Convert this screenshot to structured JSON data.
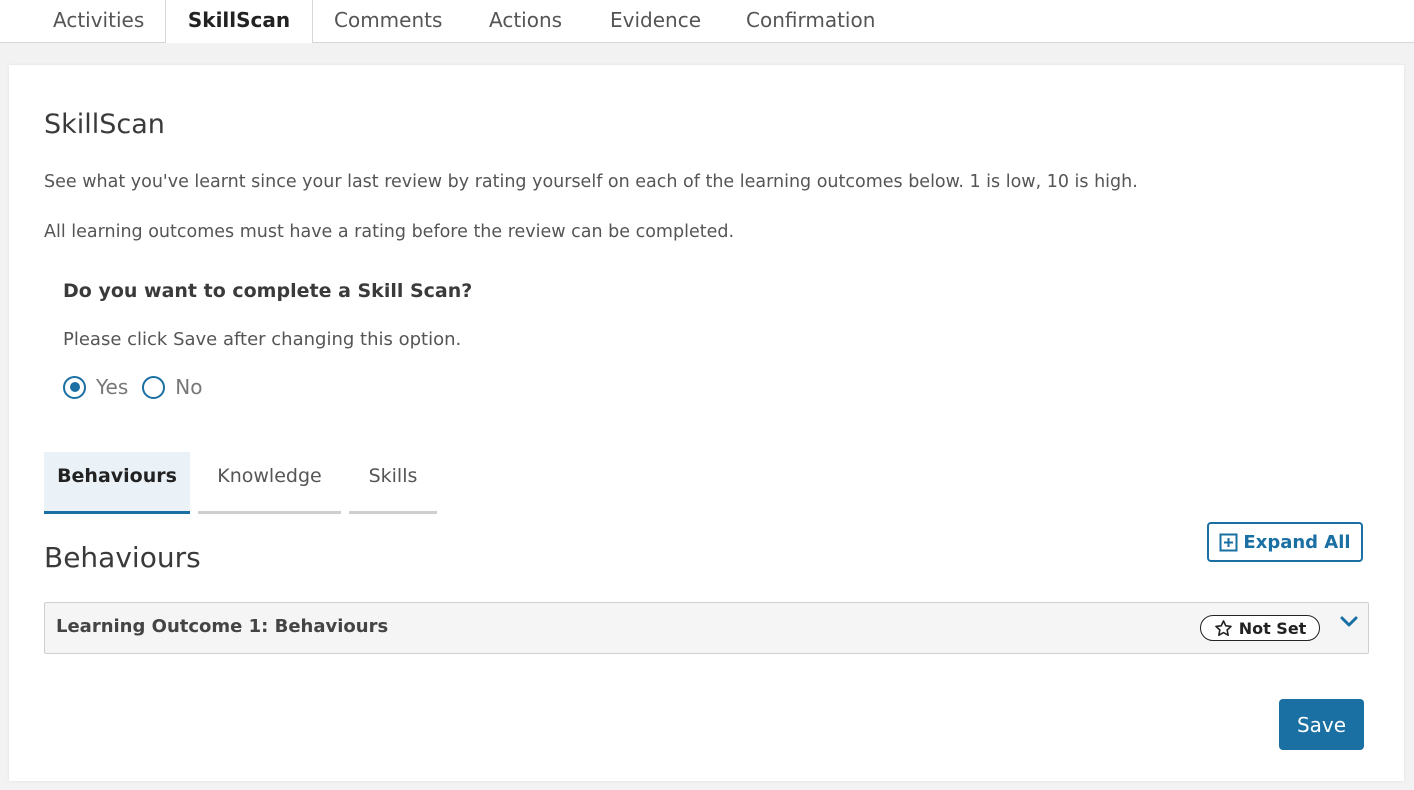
{
  "top_tabs": [
    {
      "label": "Activities",
      "active": false
    },
    {
      "label": "SkillScan",
      "active": true
    },
    {
      "label": "Comments",
      "active": false
    },
    {
      "label": "Actions",
      "active": false
    },
    {
      "label": "Evidence",
      "active": false
    },
    {
      "label": "Confirmation",
      "active": false
    }
  ],
  "skillscan": {
    "title": "SkillScan",
    "intro_1": "See what you've learnt since your last review by rating yourself on each of the learning outcomes below. 1 is low, 10 is high.",
    "intro_2": "All learning outcomes must have a rating before the review can be completed.",
    "question": "Do you want to complete a Skill Scan?",
    "hint": "Please click Save after changing this option.",
    "options": [
      {
        "label": "Yes",
        "checked": true
      },
      {
        "label": "No",
        "checked": false
      }
    ]
  },
  "sub_tabs": [
    {
      "label": "Behaviours",
      "active": true
    },
    {
      "label": "Knowledge",
      "active": false
    },
    {
      "label": "Skills",
      "active": false
    }
  ],
  "section": {
    "title": "Behaviours",
    "expand_all_label": "Expand All"
  },
  "outcomes": [
    {
      "title": "Learning Outcome 1: Behaviours",
      "status": "Not Set"
    }
  ],
  "save_label": "Save",
  "colors": {
    "accent": "#1a6fa3",
    "active_tab_bg": "#eaf2f8",
    "accordion_bg": "#f5f5f5",
    "page_bg": "#f2f2f2"
  },
  "icons": {
    "expand": "plus-square-icon",
    "status": "star-outline-icon",
    "accordion": "chevron-down-icon"
  }
}
